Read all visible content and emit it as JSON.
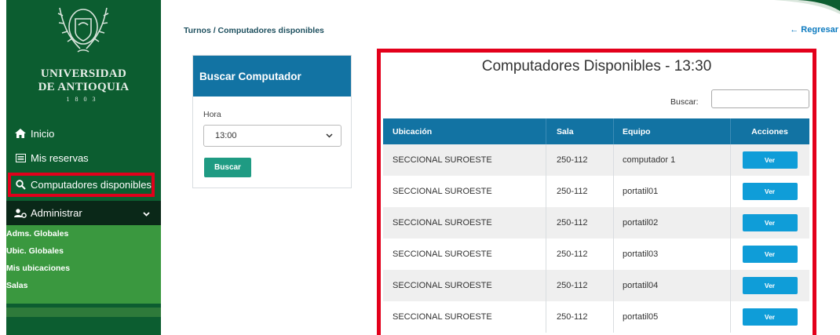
{
  "sidebar": {
    "logo": {
      "name_line1": "UNIVERSIDAD",
      "name_line2": "DE ANTIOQUIA",
      "year": "1803"
    },
    "items": [
      {
        "label": "Inicio",
        "icon": "home-icon"
      },
      {
        "label": "Mis reservas",
        "icon": "calendar-list-icon"
      },
      {
        "label": "Computadores disponibles",
        "icon": "search-icon"
      },
      {
        "label": "Administrar",
        "icon": "users-cog-icon"
      }
    ],
    "submenu": [
      "Adms. Globales",
      "Ubic. Globales",
      "Mis ubicaciones",
      "Salas"
    ]
  },
  "header": {
    "breadcrumb": "Turnos / Computadores disponibles",
    "back_label": "← Regresar"
  },
  "search_panel": {
    "title": "Buscar Computador",
    "hour_label": "Hora",
    "hour_value": "13:00",
    "submit_label": "Buscar"
  },
  "results": {
    "title": "Computadores Disponibles - 13:30",
    "search_label": "Buscar:",
    "search_value": "",
    "columns": [
      "Ubicación",
      "Sala",
      "Equipo",
      "Acciones"
    ],
    "rows": [
      {
        "ubicacion": "SECCIONAL SUROESTE",
        "sala": "250-112",
        "equipo": "computador 1",
        "accion": "Ver"
      },
      {
        "ubicacion": "SECCIONAL SUROESTE",
        "sala": "250-112",
        "equipo": "portatil01",
        "accion": "Ver"
      },
      {
        "ubicacion": "SECCIONAL SUROESTE",
        "sala": "250-112",
        "equipo": "portatil02",
        "accion": "Ver"
      },
      {
        "ubicacion": "SECCIONAL SUROESTE",
        "sala": "250-112",
        "equipo": "portatil03",
        "accion": "Ver"
      },
      {
        "ubicacion": "SECCIONAL SUROESTE",
        "sala": "250-112",
        "equipo": "portatil04",
        "accion": "Ver"
      },
      {
        "ubicacion": "SECCIONAL SUROESTE",
        "sala": "250-112",
        "equipo": "portatil05",
        "accion": "Ver"
      }
    ]
  },
  "colors": {
    "sidebar": "#0c5d30",
    "submenu": "#3a983f",
    "panel_header": "#1273a3",
    "highlight": "#e3001b",
    "button_teal": "#1f9b83",
    "button_blue": "#0f9dd8"
  }
}
